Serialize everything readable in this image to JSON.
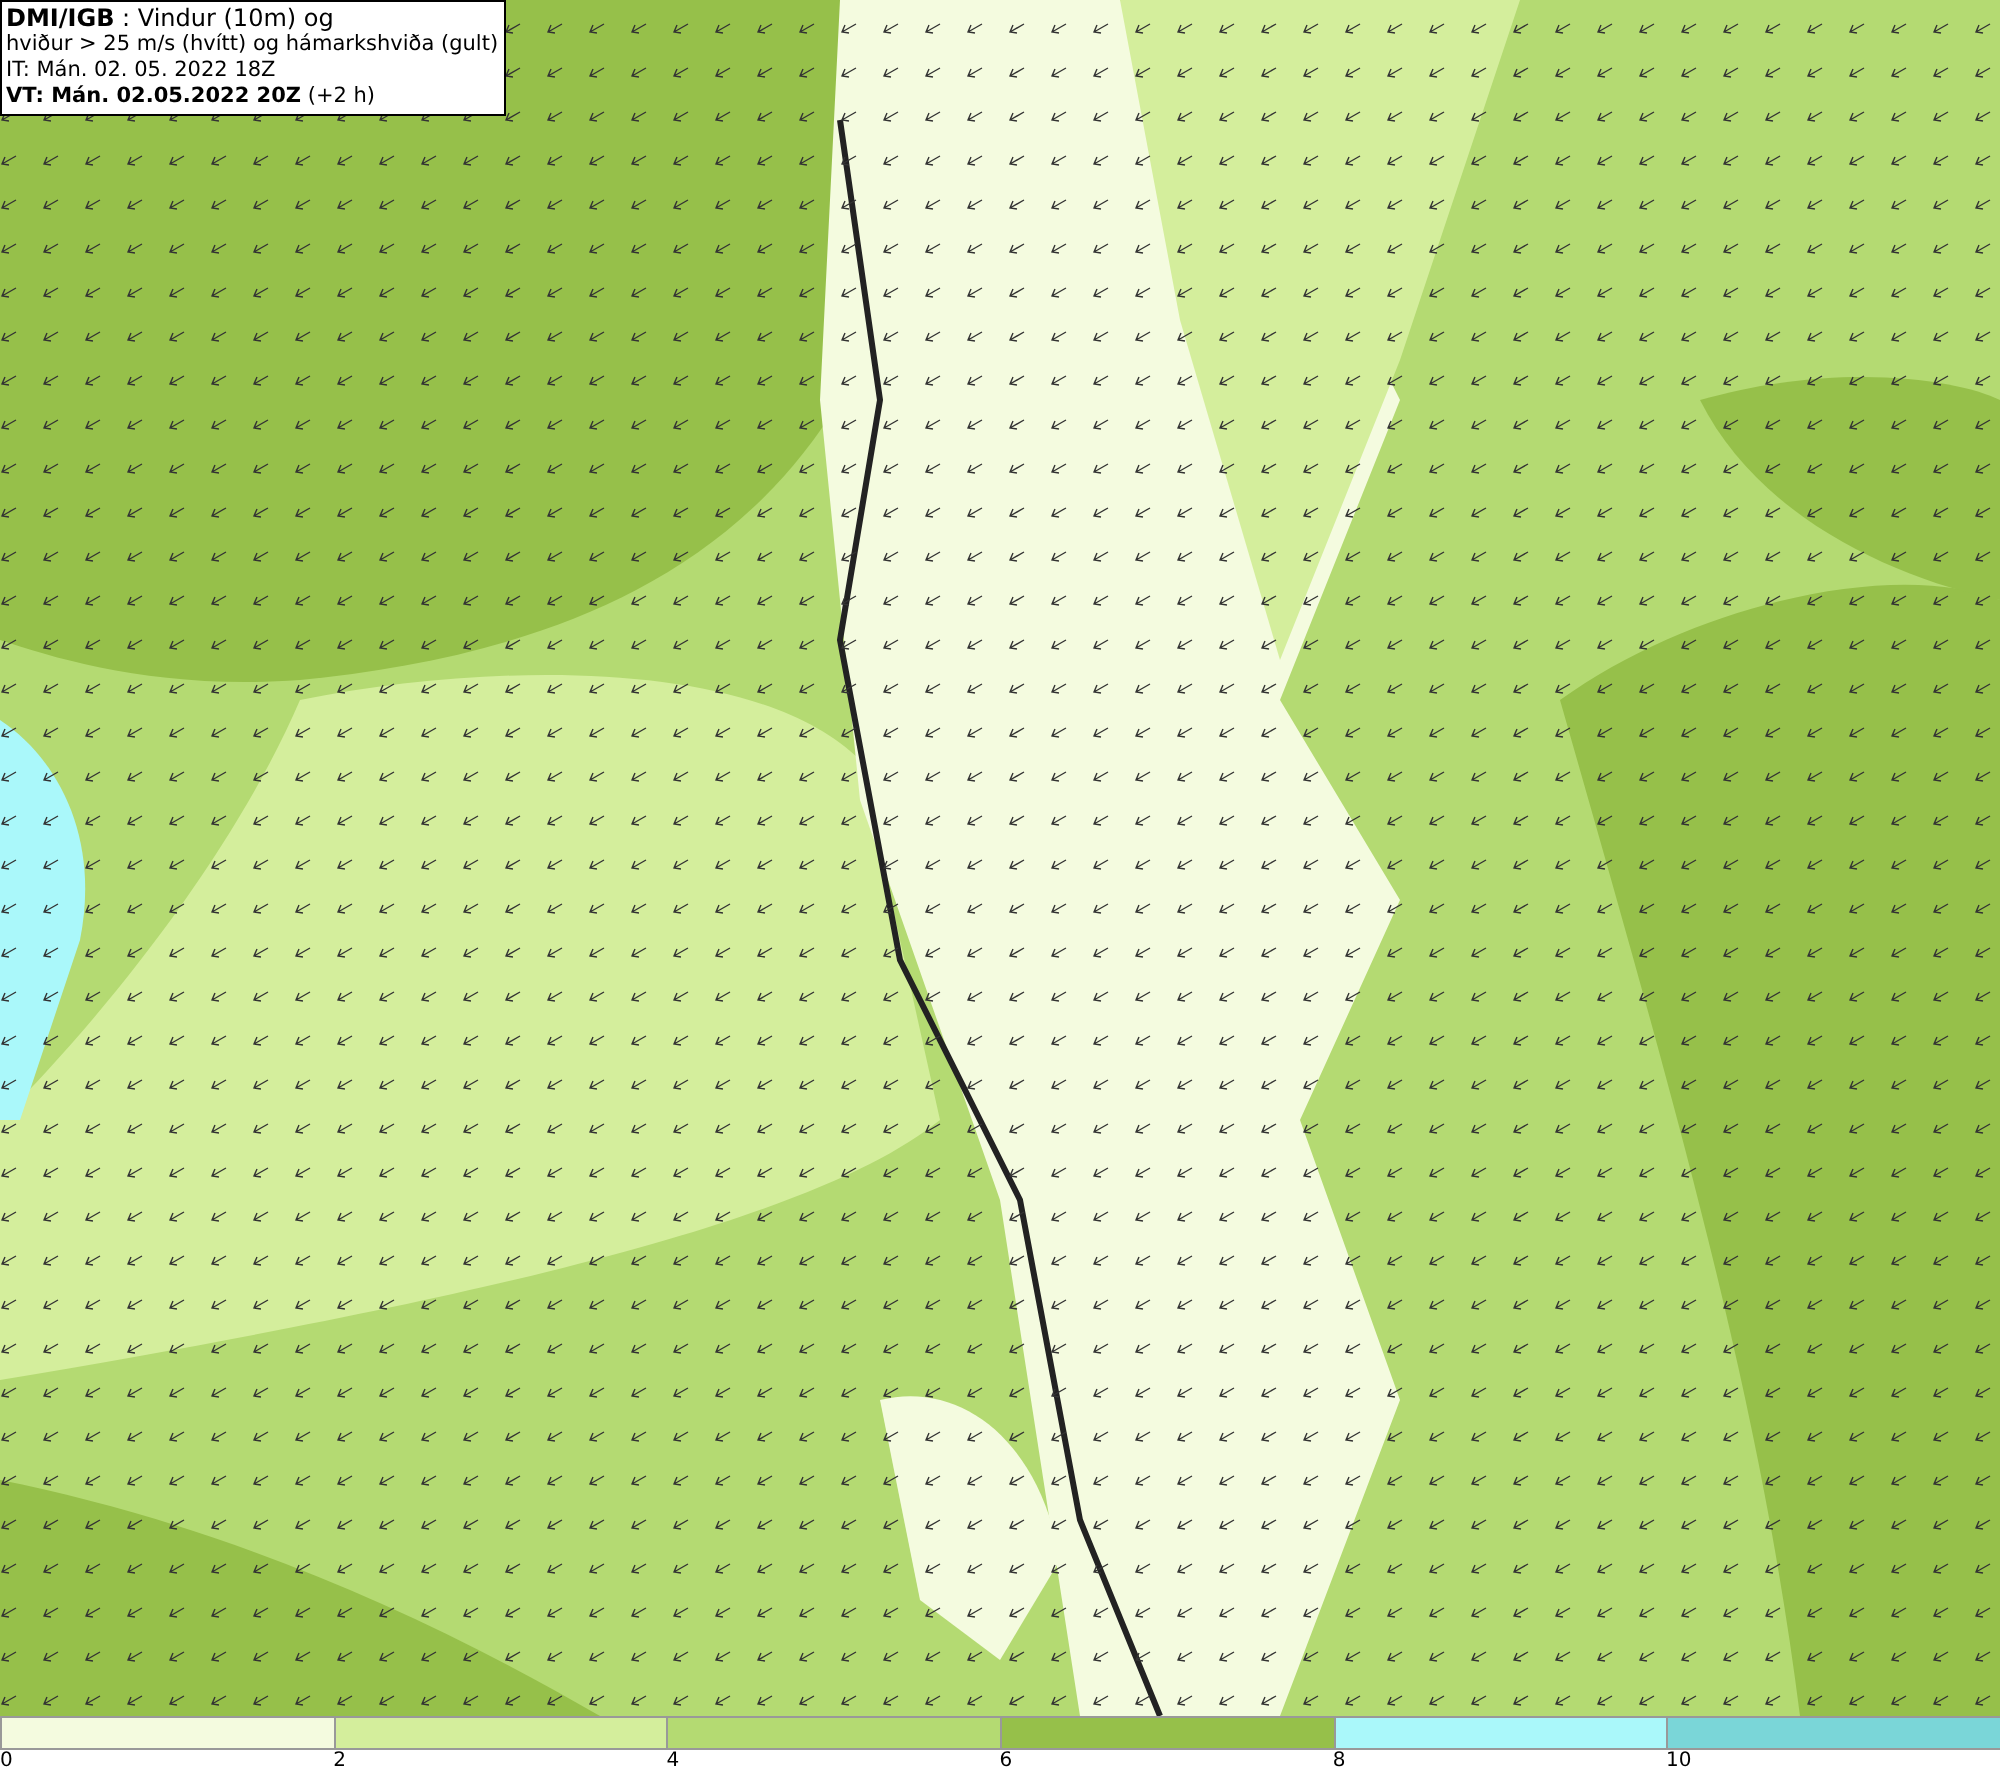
{
  "title_box": {
    "lines": [
      "**DMI/IGB** : Vindur (10m) og",
      "hviður > 25 m/s (hvítt) og hámarkshviða (gult)",
      "IT: Mán. 02. 05. 2022 18Z",
      "**VT: Mán. 02.05.2022 20Z** (+2 h)"
    ]
  },
  "legend": {
    "bins": [
      {
        "color": "#f4fbdf"
      },
      {
        "color": "#d4ee9c"
      },
      {
        "color": "#b4da72"
      },
      {
        "color": "#96c04a"
      },
      {
        "color": "#aaf8fa"
      },
      {
        "color": "#7ad6d8"
      }
    ],
    "ticks": [
      "0",
      "2",
      "4",
      "6",
      "8",
      "10"
    ]
  }
}
